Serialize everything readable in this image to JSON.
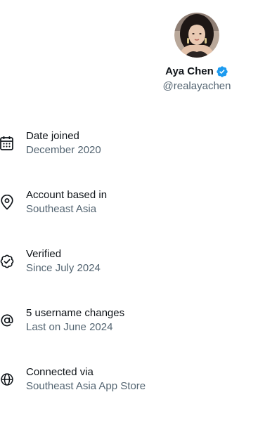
{
  "profile": {
    "display_name": "Aya Chen",
    "handle": "@realayachen",
    "verified": true,
    "badge_color": "#1d9bf0",
    "avatar_icon": "avatar"
  },
  "about": {
    "items": [
      {
        "icon": "calendar-icon",
        "label": "Date joined",
        "value": "December 2020"
      },
      {
        "icon": "location-pin-icon",
        "label": "Account based in",
        "value": "Southeast Asia"
      },
      {
        "icon": "verified-check-icon",
        "label": "Verified",
        "value": "Since July 2024"
      },
      {
        "icon": "at-sign-icon",
        "label": "5 username changes",
        "value": "Last on June 2024"
      },
      {
        "icon": "globe-icon",
        "label": "Connected via",
        "value": "Southeast Asia App Store"
      }
    ]
  },
  "colors": {
    "primary_text": "#0f1419",
    "secondary_text": "#536471",
    "accent": "#1d9bf0"
  }
}
